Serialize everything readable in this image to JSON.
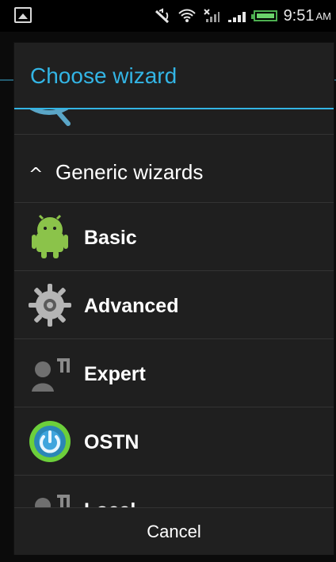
{
  "status_bar": {
    "time": "9:51",
    "ampm": "AM",
    "icons": [
      "image-icon",
      "no-sync-icon",
      "wifi-icon",
      "mobile-no-signal-icon",
      "signal-icon",
      "battery-icon"
    ]
  },
  "dialog": {
    "title": "Choose wizard",
    "group_header": "Generic wizards",
    "items": [
      {
        "label": "Basic",
        "icon": "android-icon"
      },
      {
        "label": "Advanced",
        "icon": "gear-icon"
      },
      {
        "label": "Expert",
        "icon": "user-tools-icon"
      },
      {
        "label": "OSTN",
        "icon": "power-icon"
      },
      {
        "label": "Local",
        "icon": "user-tools-icon"
      }
    ],
    "cancel_label": "Cancel"
  },
  "colors": {
    "accent": "#33b5e5",
    "background": "#1f1f1f",
    "statusbar": "#000000"
  }
}
